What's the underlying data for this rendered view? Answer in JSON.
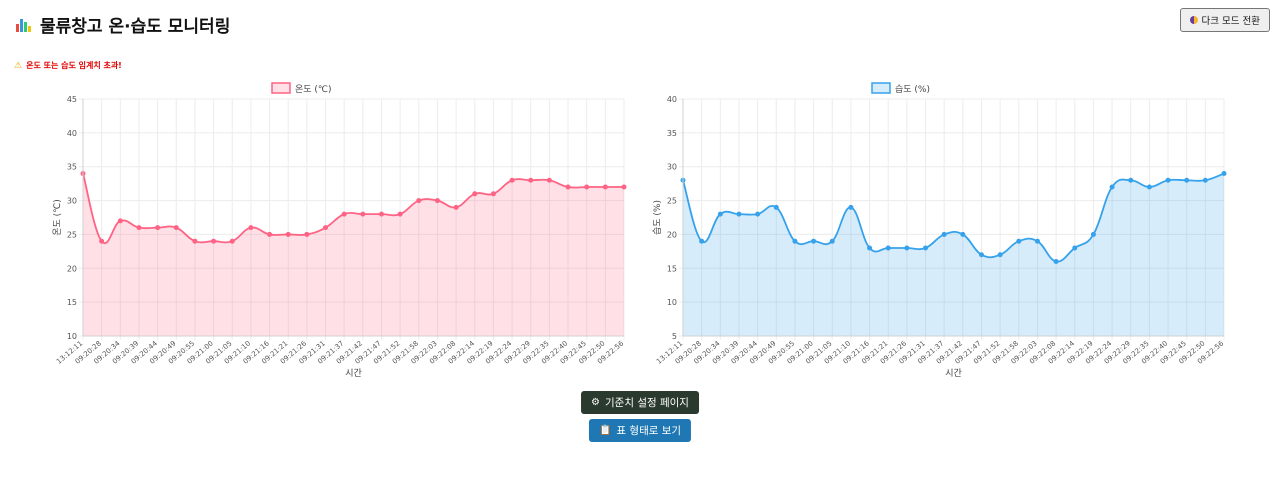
{
  "header": {
    "title": "물류창고 온·습도 모니터링",
    "dark_mode_button": "다크 모드 전환"
  },
  "alert": {
    "text": "온도 또는 습도 임계치 초과!"
  },
  "buttons": {
    "settings": "기준치 설정 페이지",
    "table_view": "표 형태로 보기"
  },
  "x_labels": [
    "13:12:11",
    "09:20:28",
    "09:20:34",
    "09:20:39",
    "09:20:44",
    "09:20:49",
    "09:20:55",
    "09:21:00",
    "09:21:05",
    "09:21:10",
    "09:21:16",
    "09:21:21",
    "09:21:26",
    "09:21:31",
    "09:21:37",
    "09:21:42",
    "09:21:47",
    "09:21:52",
    "09:21:58",
    "09:22:03",
    "09:22:08",
    "09:22:14",
    "09:22:19",
    "09:22:24",
    "09:22:29",
    "09:22:35",
    "09:22:40",
    "09:22:45",
    "09:22:50",
    "09:22:56"
  ],
  "chart_data": [
    {
      "type": "line",
      "legend": "온도 (℃)",
      "ylabel": "온도 (℃)",
      "xlabel": "시간",
      "ylim": [
        10,
        45
      ],
      "yticks": [
        10,
        15,
        20,
        25,
        30,
        35,
        40,
        45
      ],
      "color": "#ff6384",
      "fill": "rgba(255,99,132,0.2)",
      "values": [
        34,
        24,
        27,
        26,
        26,
        26,
        24,
        24,
        24,
        26,
        25,
        25,
        25,
        26,
        28,
        28,
        28,
        28,
        30,
        30,
        29,
        31,
        31,
        33,
        33,
        33,
        32,
        32,
        32,
        32
      ]
    },
    {
      "type": "line",
      "legend": "습도 (%)",
      "ylabel": "습도 (%)",
      "xlabel": "시간",
      "ylim": [
        5,
        40
      ],
      "yticks": [
        5,
        10,
        15,
        20,
        25,
        30,
        35,
        40
      ],
      "color": "#36a2eb",
      "fill": "rgba(54,162,235,0.2)",
      "values": [
        28,
        19,
        23,
        23,
        23,
        24,
        19,
        19,
        19,
        24,
        18,
        18,
        18,
        18,
        20,
        20,
        17,
        17,
        19,
        19,
        16,
        18,
        20,
        27,
        28,
        27,
        28,
        28,
        28,
        29
      ]
    }
  ]
}
